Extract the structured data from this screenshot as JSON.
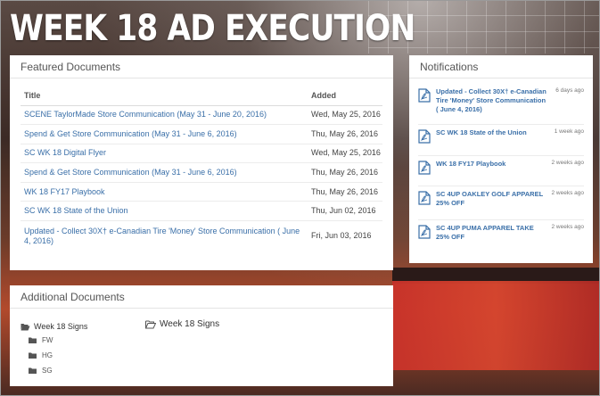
{
  "page_title": "WEEK 18 AD EXECUTION",
  "featured": {
    "header": "Featured Documents",
    "columns": {
      "title": "Title",
      "added": "Added"
    },
    "rows": [
      {
        "title": "SCENE TaylorMade Store Communication (May 31 - June 20, 2016)",
        "added": "Wed, May 25, 2016"
      },
      {
        "title": "Spend & Get Store Communication (May 31 - June 6, 2016)",
        "added": "Thu, May 26, 2016"
      },
      {
        "title": "SC WK 18 Digital Flyer",
        "added": "Wed, May 25, 2016"
      },
      {
        "title": "Spend & Get Store Communication (May 31 - June 6, 2016)",
        "added": "Thu, May 26, 2016"
      },
      {
        "title": "WK 18 FY17 Playbook",
        "added": "Thu, May 26, 2016"
      },
      {
        "title": "SC WK 18 State of the Union",
        "added": "Thu, Jun 02, 2016"
      },
      {
        "title": "Updated - Collect 30X† e-Canadian Tire 'Money' Store Communication ( June 4, 2016)",
        "added": "Fri, Jun 03, 2016"
      }
    ]
  },
  "notifications": {
    "header": "Notifications",
    "items": [
      {
        "title": "Updated - Collect 30X† e-Canadian Tire 'Money' Store Communication ( June 4, 2016)",
        "time": "6 days ago"
      },
      {
        "title": "SC WK 18 State of the Union",
        "time": "1 week ago"
      },
      {
        "title": "WK 18 FY17 Playbook",
        "time": "2 weeks ago"
      },
      {
        "title": "SC 4UP OAKLEY GOLF APPAREL 25% OFF",
        "time": "2 weeks ago"
      },
      {
        "title": "SC 4UP PUMA APPAREL TAKE 25% OFF",
        "time": "2 weeks ago"
      }
    ]
  },
  "additional": {
    "header": "Additional Documents",
    "tree_root": "Week 18 Signs",
    "tree_children": [
      "FW",
      "HG",
      "SG"
    ],
    "folder_view_title": "Week 18 Signs"
  },
  "colors": {
    "link": "#3a6fa8",
    "pdf_icon": "#3a6fa8",
    "title_text": "#ffffff"
  },
  "icons": {
    "file": "pdf-file-icon",
    "folder_open": "folder-open-icon",
    "folder": "folder-icon"
  }
}
